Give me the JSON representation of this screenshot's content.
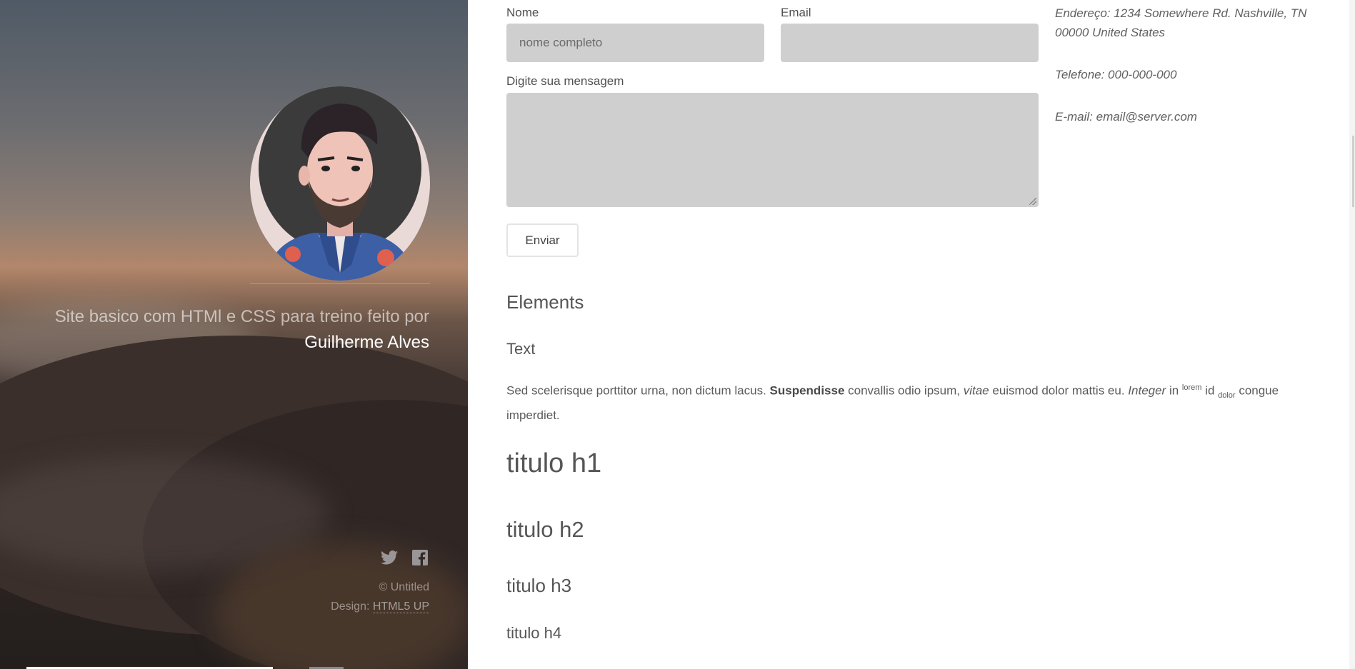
{
  "sidebar": {
    "tagline": "Site basico com HTMl e CSS para treino feito por",
    "author": "Guilherme Alves",
    "social": [
      {
        "icon": "twitter-icon"
      },
      {
        "icon": "facebook-icon"
      }
    ],
    "copyright": "© Untitled",
    "design_label": "Design:",
    "design_link": "HTML5 UP"
  },
  "form": {
    "name_label": "Nome",
    "name_placeholder": "nome completo",
    "email_label": "Email",
    "email_value": "",
    "message_label": "Digite sua mensagem",
    "message_value": "",
    "submit_label": "Enviar"
  },
  "contact": {
    "address": "Endereço: 1234 Somewhere Rd. Nashville, TN 00000 United States",
    "phone": "Telefone: 000-000-000",
    "email": "E-mail: email@server.com"
  },
  "elements": {
    "title": "Elements",
    "text_title": "Text",
    "paragraph": {
      "p1": "Sed scelerisque porttitor urna, non dictum lacus. ",
      "bold": "Suspendisse",
      "p2": " convallis odio ipsum, ",
      "italic": "vitae",
      "p3": " euismod dolor mattis eu. ",
      "italic2": "Integer",
      "p4": " in ",
      "sup": "lorem",
      "p5": " id ",
      "sub": "dolor",
      "p6": " congue imperdiet."
    },
    "h1": "titulo h1",
    "h2": "titulo h2",
    "h3": "titulo h3",
    "h4": "titulo h4"
  },
  "colors": {
    "sidebar_bg": "#2c2523",
    "field_bg": "#cfcfcf",
    "text": "#505050"
  }
}
